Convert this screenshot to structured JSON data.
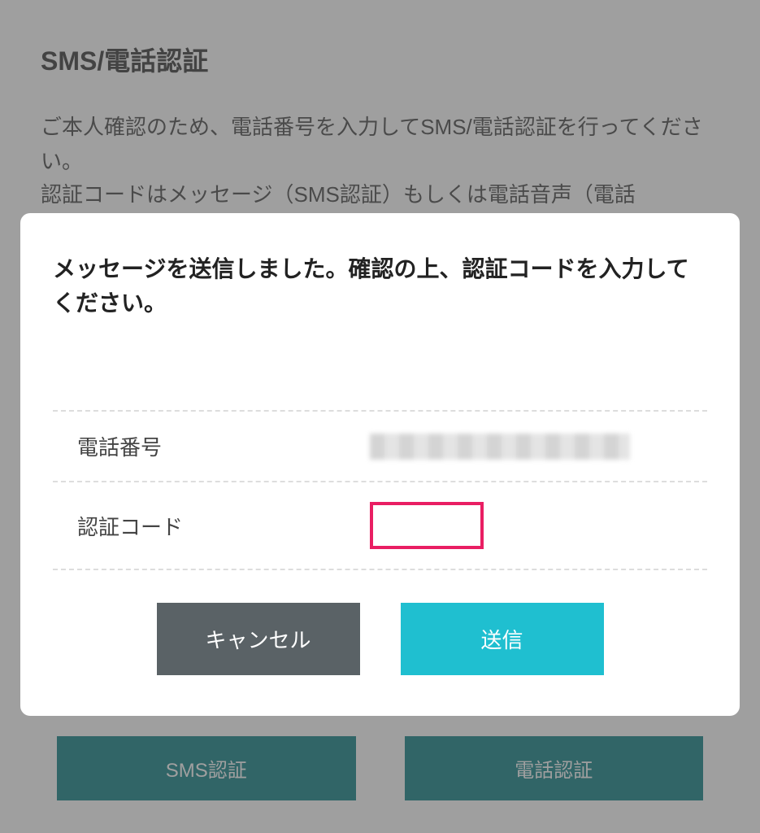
{
  "background": {
    "title": "SMS/電話認証",
    "description": "ご本人確認のため、電話番号を入力してSMS/電話認証を行ってください。\n認証コードはメッセージ（SMS認証）もしくは電話音声（電話",
    "sms_button_label": "SMS認証",
    "phone_button_label": "電話認証"
  },
  "modal": {
    "title": "メッセージを送信しました。確認の上、認証コードを入力してください。",
    "phone_label": "電話番号",
    "phone_value_redacted": true,
    "code_label": "認証コード",
    "code_value": "",
    "cancel_label": "キャンセル",
    "submit_label": "送信"
  },
  "colors": {
    "accent_pink": "#e91e63",
    "accent_teal": "#1fbfd0",
    "button_gray": "#5a6266",
    "bg_teal": "#0d7e84"
  }
}
